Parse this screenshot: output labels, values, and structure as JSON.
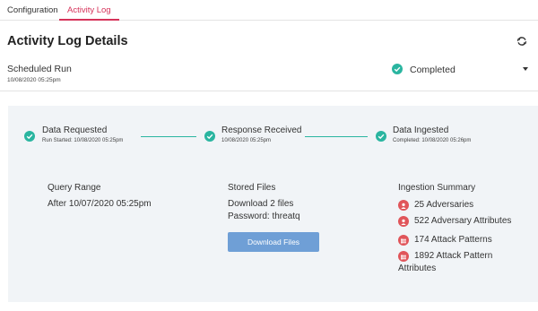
{
  "tabs": [
    {
      "label": "Configuration",
      "active": false
    },
    {
      "label": "Activity Log",
      "active": true
    }
  ],
  "header": {
    "title": "Activity Log Details",
    "refresh_icon": "refresh-icon"
  },
  "run": {
    "title": "Scheduled Run",
    "date": "10/08/2020 05:25pm",
    "status": "Completed",
    "status_icon": "check-circle-icon",
    "caret_icon": "caret-down-icon"
  },
  "steps": [
    {
      "title": "Data Requested",
      "subtitle": "Run Started: 10/08/2020 05:25pm"
    },
    {
      "title": "Response Received",
      "subtitle": "10/08/2020 05:25pm"
    },
    {
      "title": "Data Ingested",
      "subtitle": "Completed: 10/08/2020 05:26pm"
    }
  ],
  "query": {
    "title": "Query Range",
    "value": "After 10/07/2020 05:25pm"
  },
  "stored": {
    "title": "Stored Files",
    "files": "Download 2 files",
    "password": "Password: threatq",
    "button_label": "Download Files"
  },
  "summary": {
    "title": "Ingestion Summary",
    "items": [
      {
        "label": "25 Adversaries",
        "icon": "adversary-icon"
      },
      {
        "label": "522 Adversary Attributes",
        "icon": "adversary-icon"
      },
      {
        "label": "174 Attack Patterns",
        "icon": "attack-pattern-icon"
      },
      {
        "label": "1892 Attack Pattern",
        "label2": "Attributes",
        "icon": "attack-pattern-icon"
      }
    ]
  },
  "colors": {
    "accent": "#d6335a",
    "success": "#2ab5a0",
    "button": "#6f9fd6",
    "summary_icon": "#e0555a",
    "panel": "#f1f4f7"
  }
}
